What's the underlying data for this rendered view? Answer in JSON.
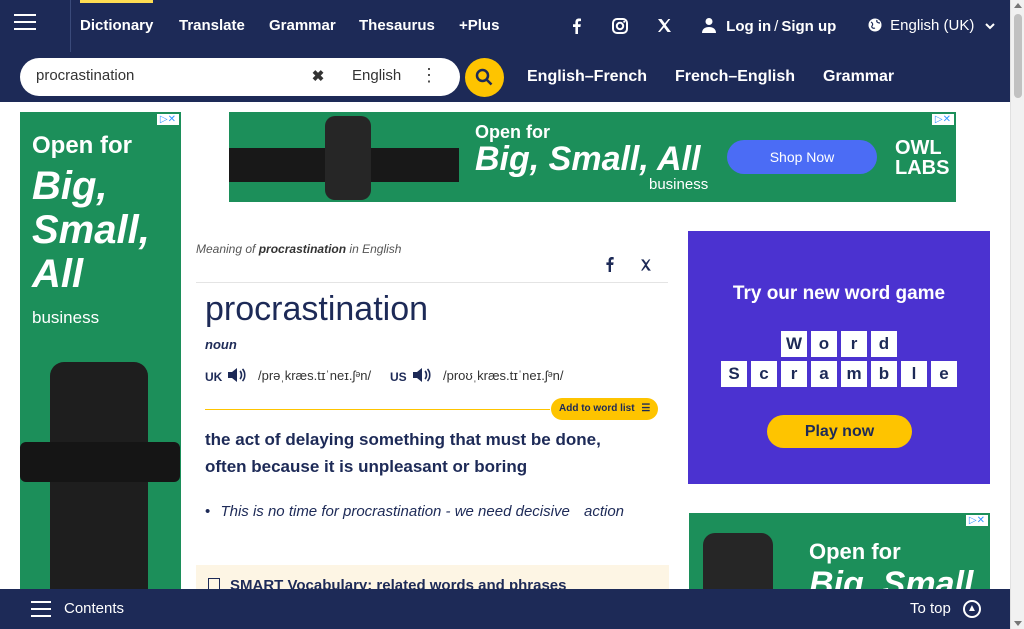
{
  "header": {
    "nav": [
      "Dictionary",
      "Translate",
      "Grammar",
      "Thesaurus",
      "+Plus"
    ],
    "login": "Log in",
    "signup": "Sign up",
    "language": "English (UK)"
  },
  "search": {
    "value": "procrastination",
    "dictionary": "English"
  },
  "subnav": [
    "English–French",
    "French–English",
    "Grammar"
  ],
  "ads": {
    "left": {
      "open": "Open for",
      "big": "Big, Small, All",
      "business": "business"
    },
    "top": {
      "open": "Open for",
      "big": "Big, Small, All",
      "business": "business",
      "cta": "Shop Now",
      "brand": "OWL LABS"
    },
    "right": {
      "title": "Try our new word game",
      "row1": [
        "W",
        "o",
        "r",
        "d"
      ],
      "row2": [
        "S",
        "c",
        "r",
        "a",
        "m",
        "b",
        "l",
        "e"
      ],
      "cta": "Play now"
    },
    "right2": {
      "open": "Open for",
      "big": "Big, Small, All"
    }
  },
  "entry": {
    "meaning_prefix": "Meaning of",
    "meaning_word": "procrastination",
    "meaning_suffix": "in English",
    "headword": "procrastination",
    "pos": "noun",
    "uk_label": "UK",
    "uk_ipa": "/prəˌkræs.tɪˈneɪ.ʃᵊn/",
    "us_label": "US",
    "us_ipa": "/proʊˌkræs.tɪˈneɪ.ʃᵊn/",
    "add_to_list": "Add to word list",
    "definition": {
      "p1": "the",
      "w1": "act",
      "p2": "of",
      "w2": "delaying",
      "p3": "something that must be done,",
      "p4": "often because it is",
      "w3": "unpleasant",
      "p5": "or",
      "w4": "boring"
    },
    "example": {
      "p1": "This is no",
      "w1": "time",
      "p2": "for procrastination - we need",
      "w2": "decisive",
      "w3": "action"
    },
    "smart_vocab": "SMART Vocabulary: related words and phrases"
  },
  "footer": {
    "contents": "Contents",
    "to_top": "To top"
  },
  "colors": {
    "navy": "#1d2a57",
    "accent": "#fec400",
    "ad_green": "#1c8f5a",
    "game_purple": "#4b32d0"
  }
}
